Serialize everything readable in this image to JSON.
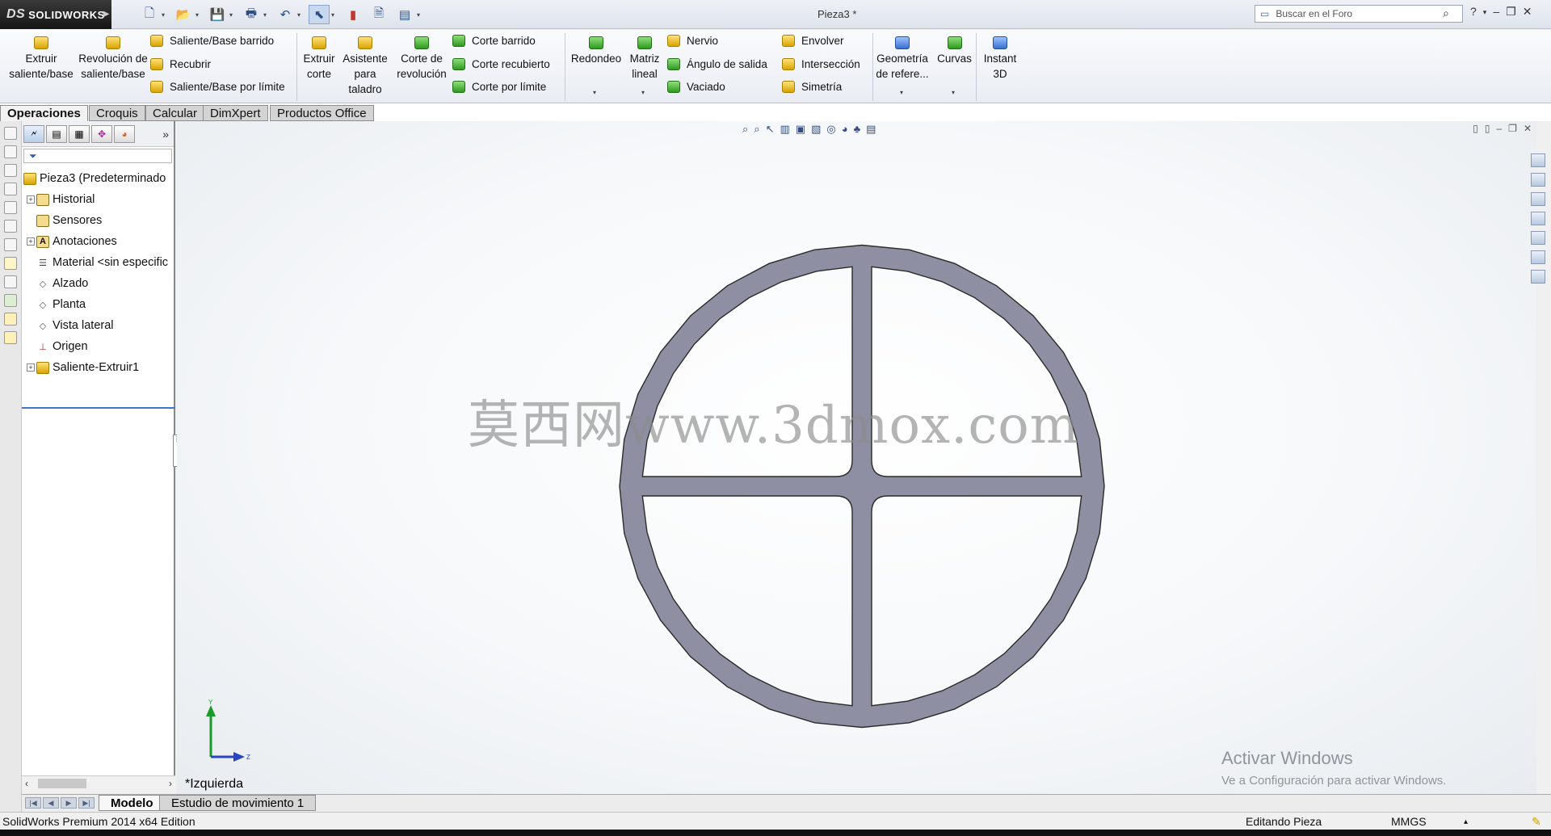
{
  "app": {
    "brand": "SOLIDWORKS",
    "brand_prefix": "DS",
    "document_title": "Pieza3 *"
  },
  "search": {
    "placeholder": "Buscar en el Foro"
  },
  "quick_access": [
    "new-icon",
    "open-icon",
    "save-icon",
    "print-icon",
    "undo-icon",
    "select-icon",
    "rebuild-icon",
    "file-properties-icon",
    "options-icon"
  ],
  "ribbon": {
    "extrude_boss": "Extruir saliente/base",
    "revolve_boss": "Revolución de saliente/base",
    "swept_boss": "Saliente/Base barrido",
    "loft": "Recubrir",
    "boundary_boss": "Saliente/Base por límite",
    "extrude_cut": "Extruir corte",
    "hole_wizard": "Asistente para taladro",
    "revolve_cut": "Corte de revolución",
    "swept_cut": "Corte barrido",
    "lofted_cut": "Corte recubierto",
    "boundary_cut": "Corte por límite",
    "fillet": "Redondeo",
    "linear_pattern": "Matriz lineal",
    "rib": "Nervio",
    "draft": "Ángulo de salida",
    "shell": "Vaciado",
    "wrap": "Envolver",
    "intersect": "Intersección",
    "mirror": "Simetría",
    "ref_geometry": "Geometría de refere...",
    "curves": "Curvas",
    "instant3d": "Instant 3D"
  },
  "tabs": [
    "Operaciones",
    "Croquis",
    "Calcular",
    "DimXpert",
    "Productos Office"
  ],
  "feature_tree": {
    "root": "Pieza3  (Predeterminado",
    "items": [
      {
        "label": "Historial",
        "expandable": true
      },
      {
        "label": "Sensores",
        "expandable": false
      },
      {
        "label": "Anotaciones",
        "expandable": true
      },
      {
        "label": "Material <sin especific",
        "expandable": false
      },
      {
        "label": "Alzado",
        "expandable": false
      },
      {
        "label": "Planta",
        "expandable": false
      },
      {
        "label": "Vista lateral",
        "expandable": false
      },
      {
        "label": "Origen",
        "expandable": false
      },
      {
        "label": "Saliente-Extruir1",
        "expandable": true
      }
    ]
  },
  "viewport": {
    "view_name": "*Izquierda",
    "watermark": "莫西网www.3dmox.com",
    "activation_title": "Activar Windows",
    "activation_sub": "Ve a Configuración para activar Windows.",
    "axis_y": "Y",
    "axis_z": "Z",
    "part_color": "#8e8fa3"
  },
  "bottom_tabs": {
    "model": "Modelo",
    "motion": "Estudio de movimiento 1"
  },
  "status": {
    "edition": "SolidWorks Premium 2014 x64 Edition",
    "mode": "Editando Pieza",
    "units": "MMGS"
  }
}
